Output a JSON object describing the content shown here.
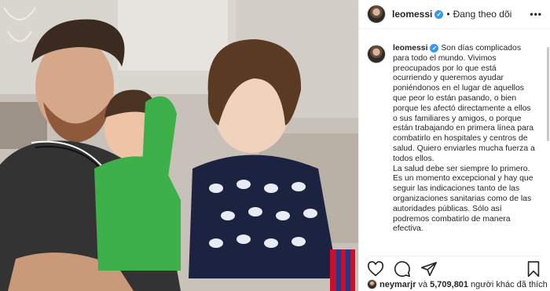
{
  "post": {
    "username": "leomessi",
    "follow_status": "Đang theo dõi",
    "more_label": "•••",
    "caption_lines": [
      "Son días complicados",
      "para todo el mundo. Vivimos",
      "preocupados por lo que está",
      "ocurriendo y queremos ayudar",
      "poniéndonos en el lugar de aquellos",
      "que peor lo están pasando, o bien",
      "porque les afectó directamente a ellos",
      "o sus familiares y amigos, o porque",
      "están trabajando en primera línea para",
      "combatirlo en hospitales y centros de",
      "salud. Quiero enviarles mucha fuerza a",
      "todos ellos.",
      "La salud debe ser siempre lo primero.",
      "Es un momento excepcional y hay que",
      "seguir las indicaciones tanto de las",
      "organizaciones sanitarias como de las",
      "autoridades públicas. Sólo así",
      "podremos combatirlo de manera",
      "efectiva."
    ]
  },
  "likes": {
    "liker": "neymarjr",
    "connector": "và",
    "count": "5,709,801",
    "suffix": "người khác đã thích"
  },
  "icons": {
    "verified": "verified-badge",
    "like": "heart-icon",
    "comment": "comment-icon",
    "share": "share-icon",
    "save": "bookmark-icon"
  },
  "colors": {
    "verified": "#3897f0",
    "text": "#262626",
    "border": "#efefef"
  }
}
